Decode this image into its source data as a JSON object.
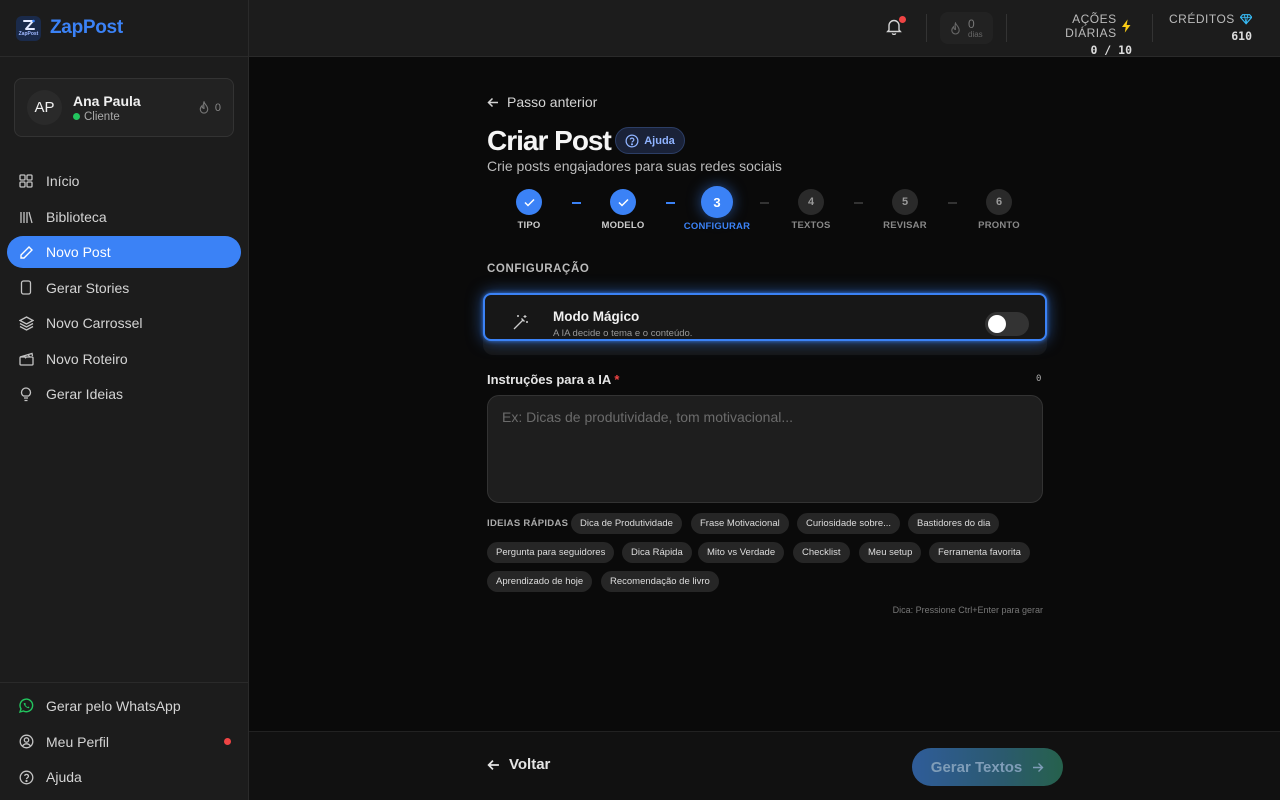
{
  "brand": {
    "name": "ZapPost",
    "logo_text": "ZapPost"
  },
  "profile": {
    "initials": "AP",
    "name": "Ana Paula",
    "role": "Cliente",
    "streak": "0"
  },
  "nav": [
    {
      "label": "Início",
      "icon": "grid-icon"
    },
    {
      "label": "Biblioteca",
      "icon": "library-icon"
    },
    {
      "label": "Novo Post",
      "icon": "pencil-icon",
      "active": true
    },
    {
      "label": "Gerar Stories",
      "icon": "phone-icon"
    },
    {
      "label": "Novo Carrossel",
      "icon": "layers-icon"
    },
    {
      "label": "Novo Roteiro",
      "icon": "clapperboard-icon"
    },
    {
      "label": "Gerar Ideias",
      "icon": "lightbulb-icon"
    }
  ],
  "nav_bottom": [
    {
      "label": "Gerar pelo WhatsApp",
      "icon": "whatsapp-icon"
    },
    {
      "label": "Meu Perfil",
      "icon": "user-circle-icon"
    },
    {
      "label": "Ajuda",
      "icon": "help-circle-icon"
    }
  ],
  "header": {
    "streak_num": "0",
    "streak_label": "dias",
    "acoes_title": "AÇÕES DIÁRIAS",
    "acoes_value": "0 / 10",
    "creditos_title": "CRÉDITOS",
    "creditos_value": "610"
  },
  "main": {
    "back_link": "Passo anterior",
    "title": "Criar Post",
    "help": "Ajuda",
    "subtitle": "Crie posts engajadores para suas redes sociais",
    "steps": [
      {
        "num": "1",
        "label": "TIPO",
        "state": "done"
      },
      {
        "num": "2",
        "label": "MODELO",
        "state": "done"
      },
      {
        "num": "3",
        "label": "CONFIGURAR",
        "state": "current"
      },
      {
        "num": "4",
        "label": "TEXTOS",
        "state": "todo"
      },
      {
        "num": "5",
        "label": "REVISAR",
        "state": "todo"
      },
      {
        "num": "6",
        "label": "PRONTO",
        "state": "todo"
      }
    ],
    "section_label": "CONFIGURAÇÃO",
    "magic": {
      "title": "Modo Mágico",
      "desc": "A IA decide o tema e o conteúdo.",
      "enabled": false
    },
    "instr_label": "Instruções para a IA",
    "instr_required": "*",
    "char_count": "0",
    "instr_placeholder": "Ex: Dicas de produtividade, tom motivacional...",
    "instr_value": "",
    "ideas_label": "IDEIAS RÁPIDAS",
    "ideas": [
      "Dica de Produtividade",
      "Frase Motivacional",
      "Curiosidade sobre...",
      "Bastidores do dia",
      "Pergunta para seguidores",
      "Dica Rápida",
      "Mito vs Verdade",
      "Checklist",
      "Meu setup",
      "Ferramenta favorita",
      "Aprendizado de hoje",
      "Recomendação de livro"
    ],
    "hint": "Dica: Pressione Ctrl+Enter para gerar"
  },
  "footer": {
    "back": "Voltar",
    "next": "Gerar Textos"
  },
  "colors": {
    "accent": "#3b82f6",
    "bg": "#0a0a0a",
    "sidebar": "#1c1c1c",
    "online": "#22c55e",
    "alert": "#ef4444"
  }
}
